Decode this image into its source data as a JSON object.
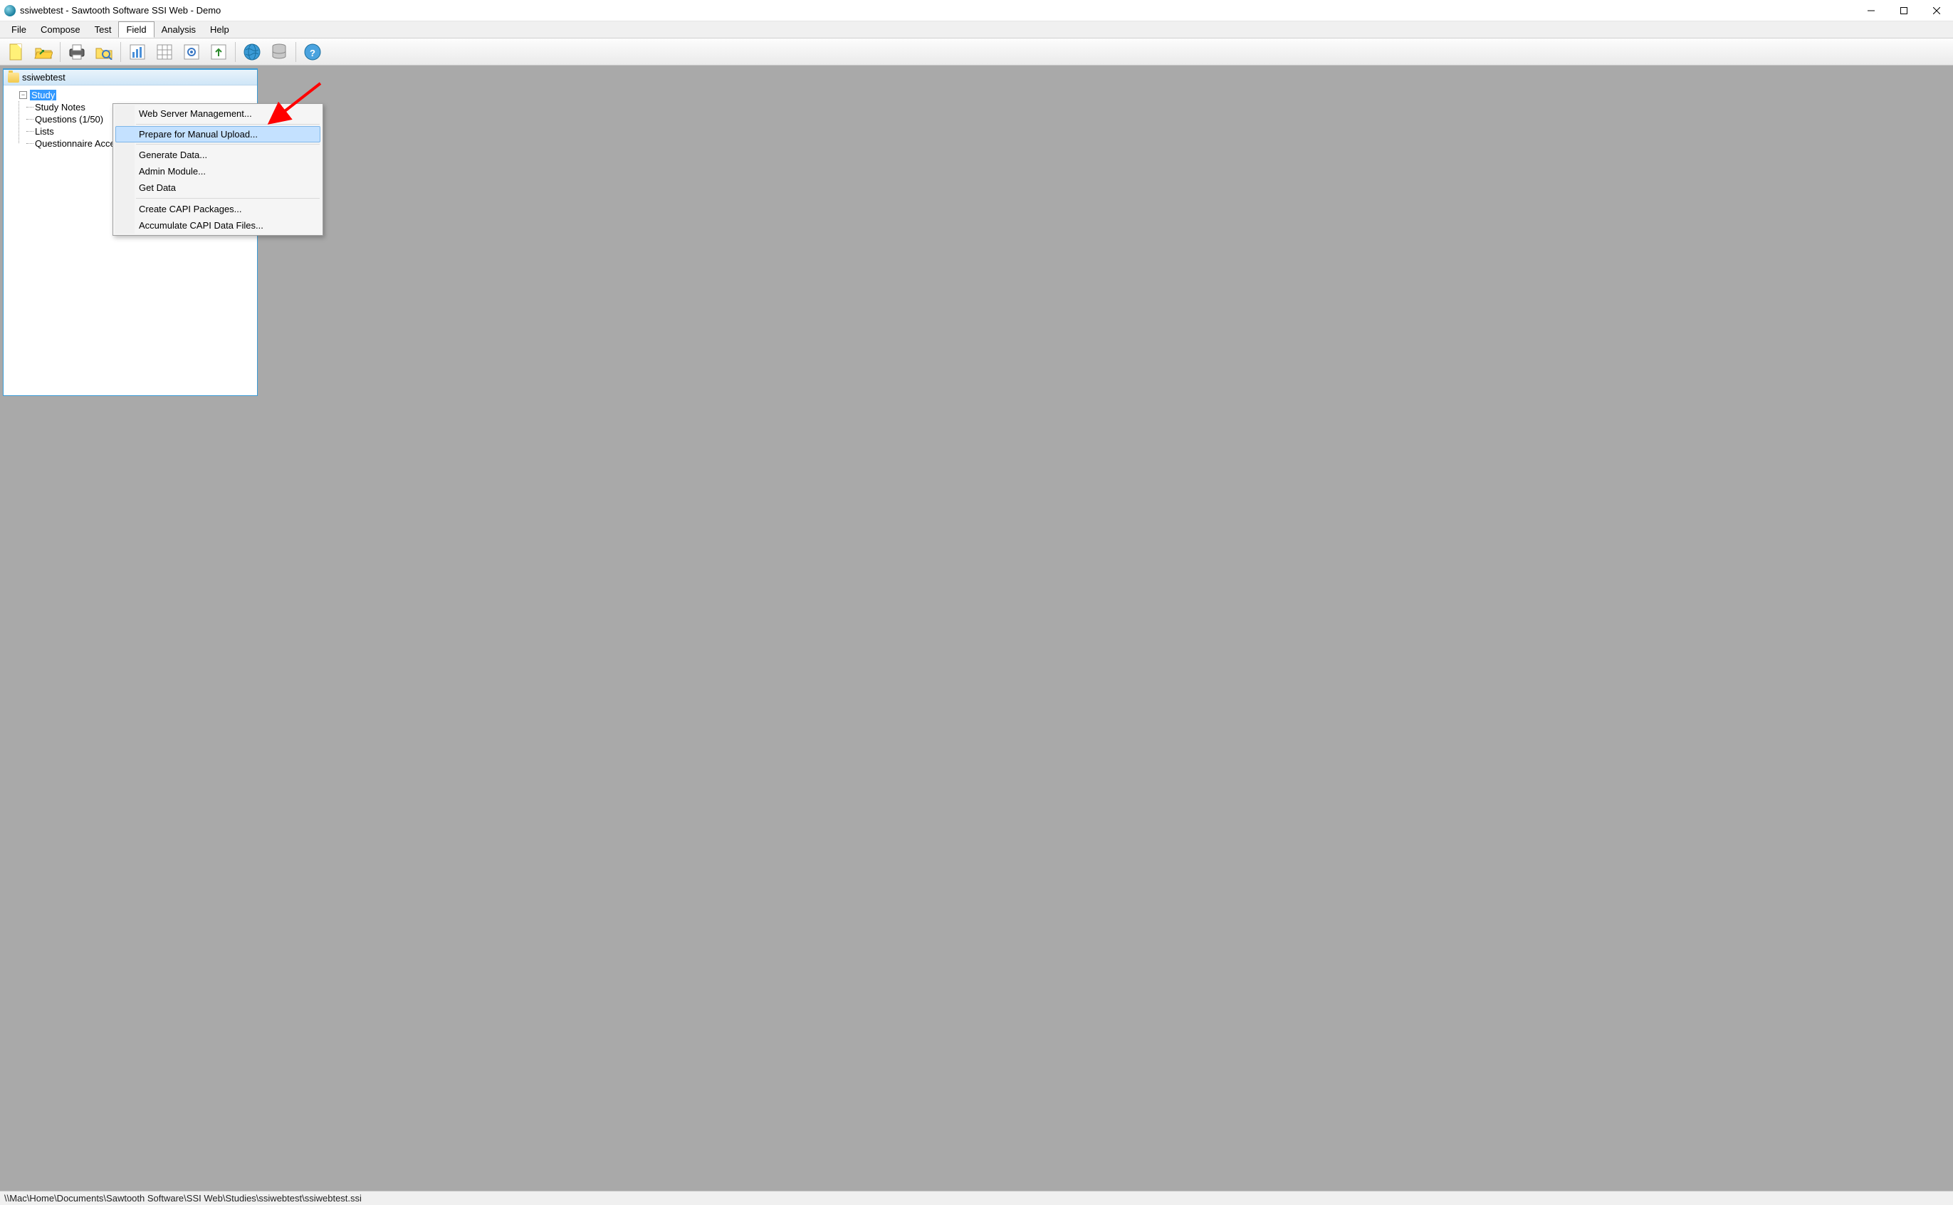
{
  "window": {
    "title": "ssiwebtest - Sawtooth Software SSI Web - Demo"
  },
  "menubar": {
    "items": [
      "File",
      "Compose",
      "Test",
      "Field",
      "Analysis",
      "Help"
    ],
    "open_index": 3
  },
  "dropdown": {
    "groups": [
      [
        "Web Server Management..."
      ],
      [
        "Prepare for Manual Upload..."
      ],
      [
        "Generate Data...",
        "Admin Module...",
        "Get Data"
      ],
      [
        "Create CAPI Packages...",
        "Accumulate CAPI Data Files..."
      ]
    ],
    "highlight": "Prepare for Manual Upload..."
  },
  "tree": {
    "root": "ssiwebtest",
    "study_label": "Study",
    "children": [
      "Study Notes",
      "Questions (1/50)",
      "Lists",
      "Questionnaire Access and Passwords"
    ]
  },
  "statusbar": {
    "path": "\\\\Mac\\Home\\Documents\\Sawtooth Software\\SSI Web\\Studies\\ssiwebtest\\ssiwebtest.ssi"
  },
  "toolbar_icons": [
    "new-file-icon",
    "open-folder-icon",
    "print-icon",
    "search-folder-icon",
    "chart-icon",
    "table-icon",
    "preview-icon",
    "upload-icon",
    "globe-icon",
    "database-icon",
    "help-icon"
  ]
}
